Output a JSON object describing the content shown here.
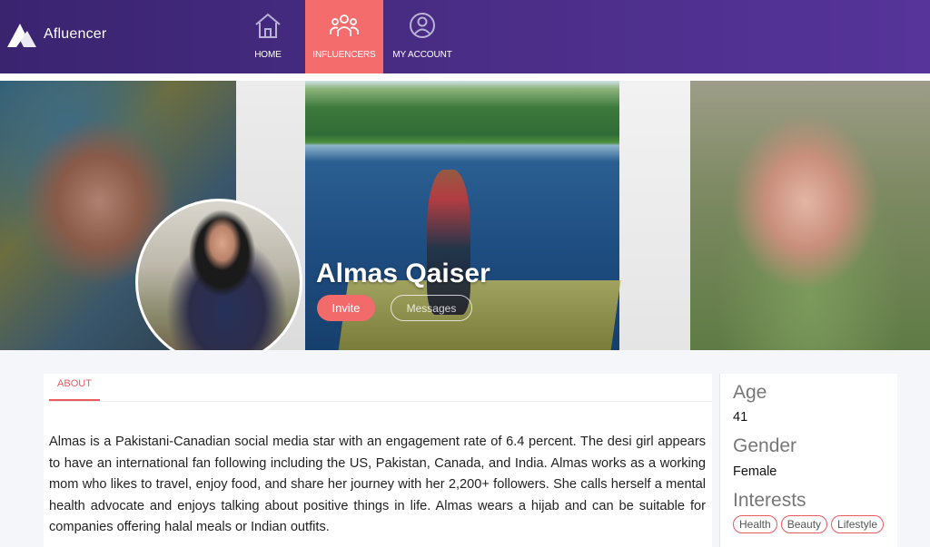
{
  "brand": {
    "name": "Afluencer",
    "logo_icon": "triangle-logo-icon"
  },
  "nav": {
    "items": [
      {
        "label": "HOME",
        "icon": "home-icon"
      },
      {
        "label": "INFLUENCERS",
        "icon": "people-icon",
        "active": true
      },
      {
        "label": "MY ACCOUNT",
        "icon": "account-icon"
      }
    ]
  },
  "colors": {
    "nav_bg": "#452a80",
    "accent": "#f26a6a"
  },
  "profile": {
    "name": "Almas Qaiser",
    "invite_label": "Invite",
    "messages_label": "Messages"
  },
  "about": {
    "tab_label": "ABOUT",
    "bio": "Almas is a Pakistani-Canadian social media star with an engagement rate of 6.4 percent. The desi girl appears to have an international fan following including the US, Pakistan, Canada, and India. Almas works as a working mom who likes to travel, enjoy food, and share her journey with her 2,200+ followers. She calls herself a mental health advocate and enjoys talking about positive things in life. Almas wears a hijab and can be suitable for companies offering halal meals or Indian outfits."
  },
  "details": {
    "age_label": "Age",
    "age_value": "41",
    "gender_label": "Gender",
    "gender_value": "Female",
    "interests_label": "Interests",
    "interests": [
      "Health",
      "Beauty",
      "Lifestyle"
    ]
  }
}
